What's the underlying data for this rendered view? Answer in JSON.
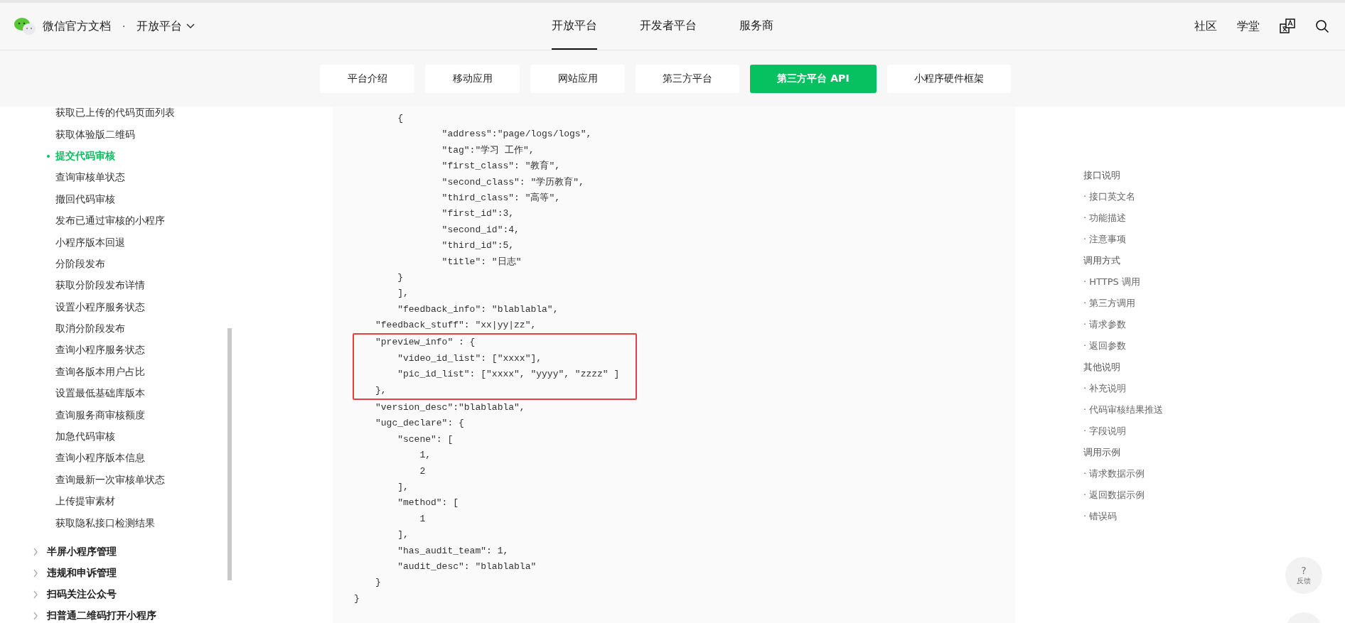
{
  "header": {
    "site_title": "微信官方文档",
    "separator": "·",
    "platform_menu": "开放平台",
    "nav": [
      {
        "label": "开放平台",
        "selected": true
      },
      {
        "label": "开发者平台",
        "selected": false
      },
      {
        "label": "服务商",
        "selected": false
      }
    ],
    "links": [
      "社区",
      "学堂"
    ]
  },
  "subnav": [
    {
      "label": "平台介绍",
      "selected": false
    },
    {
      "label": "移动应用",
      "selected": false
    },
    {
      "label": "网站应用",
      "selected": false
    },
    {
      "label": "第三方平台",
      "selected": false
    },
    {
      "label": "第三方平台 API",
      "selected": true
    },
    {
      "label": "小程序硬件框架",
      "selected": false
    }
  ],
  "sidebar": {
    "items": [
      {
        "label": "获取已上传的代码页面列表",
        "selected": false
      },
      {
        "label": "获取体验版二维码",
        "selected": false
      },
      {
        "label": "提交代码审核",
        "selected": true
      },
      {
        "label": "查询审核单状态",
        "selected": false
      },
      {
        "label": "撤回代码审核",
        "selected": false
      },
      {
        "label": "发布已通过审核的小程序",
        "selected": false
      },
      {
        "label": "小程序版本回退",
        "selected": false
      },
      {
        "label": "分阶段发布",
        "selected": false
      },
      {
        "label": "获取分阶段发布详情",
        "selected": false
      },
      {
        "label": "设置小程序服务状态",
        "selected": false
      },
      {
        "label": "取消分阶段发布",
        "selected": false
      },
      {
        "label": "查询小程序服务状态",
        "selected": false
      },
      {
        "label": "查询各版本用户占比",
        "selected": false
      },
      {
        "label": "设置最低基础库版本",
        "selected": false
      },
      {
        "label": "查询服务商审核额度",
        "selected": false
      },
      {
        "label": "加急代码审核",
        "selected": false
      },
      {
        "label": "查询小程序版本信息",
        "selected": false
      },
      {
        "label": "查询最新一次审核单状态",
        "selected": false
      },
      {
        "label": "上传提审素材",
        "selected": false
      },
      {
        "label": "获取隐私接口检测结果",
        "selected": false
      }
    ],
    "groups": [
      {
        "label": "半屏小程序管理",
        "expanded": false
      },
      {
        "label": "违规和申诉管理",
        "expanded": false
      },
      {
        "label": "扫码关注公众号",
        "expanded": false
      },
      {
        "label": "扫普通二维码打开小程序",
        "expanded": false
      }
    ]
  },
  "code": {
    "blocks": [
      {
        "highlighted": false,
        "lines": [
          "    {",
          "            \"address\":\"page/logs/logs\",",
          "            \"tag\":\"学习 工作\",",
          "            \"first_class\": \"教育\",",
          "            \"second_class\": \"学历教育\",",
          "            \"third_class\": \"高等\",",
          "            \"first_id\":3,",
          "            \"second_id\":4,",
          "            \"third_id\":5,",
          "            \"title\": \"日志\"",
          "    }",
          "    ],",
          "    \"feedback_info\": \"blablabla\",",
          "\"feedback_stuff\": \"xx|yy|zz\","
        ]
      },
      {
        "highlighted": true,
        "lines": [
          "\"preview_info\" : {",
          "    \"video_id_list\": [\"xxxx\"],",
          "    \"pic_id_list\": [\"xxxx\", \"yyyy\", \"zzzz\" ]",
          "},"
        ]
      },
      {
        "highlighted": false,
        "lines": [
          "\"version_desc\":\"blablabla\",",
          "\"ugc_declare\": {",
          "    \"scene\": [",
          "        1,",
          "        2",
          "    ],",
          "    \"method\": [",
          "        1",
          "    ],",
          "    \"has_audit_team\": 1,",
          "    \"audit_desc\": \"blablabla\"",
          "}"
        ]
      }
    ],
    "closing": "}"
  },
  "toc": [
    {
      "label": "接口说明",
      "kind": "section"
    },
    {
      "label": "· 接口英文名",
      "kind": "item"
    },
    {
      "label": "· 功能描述",
      "kind": "item"
    },
    {
      "label": "· 注意事项",
      "kind": "item"
    },
    {
      "label": "调用方式",
      "kind": "section"
    },
    {
      "label": "· HTTPS 调用",
      "kind": "item"
    },
    {
      "label": "· 第三方调用",
      "kind": "item"
    },
    {
      "label": "· 请求参数",
      "kind": "item"
    },
    {
      "label": "· 返回参数",
      "kind": "item"
    },
    {
      "label": "其他说明",
      "kind": "section"
    },
    {
      "label": "· 补充说明",
      "kind": "item"
    },
    {
      "label": "· 代码审核结果推送",
      "kind": "item"
    },
    {
      "label": "· 字段说明",
      "kind": "item"
    },
    {
      "label": "调用示例",
      "kind": "section"
    },
    {
      "label": "· 请求数据示例",
      "kind": "item"
    },
    {
      "label": "· 返回数据示例",
      "kind": "item"
    },
    {
      "label": "· 错误码",
      "kind": "item"
    }
  ],
  "feedback": {
    "mark": "?",
    "label": "反馈"
  }
}
